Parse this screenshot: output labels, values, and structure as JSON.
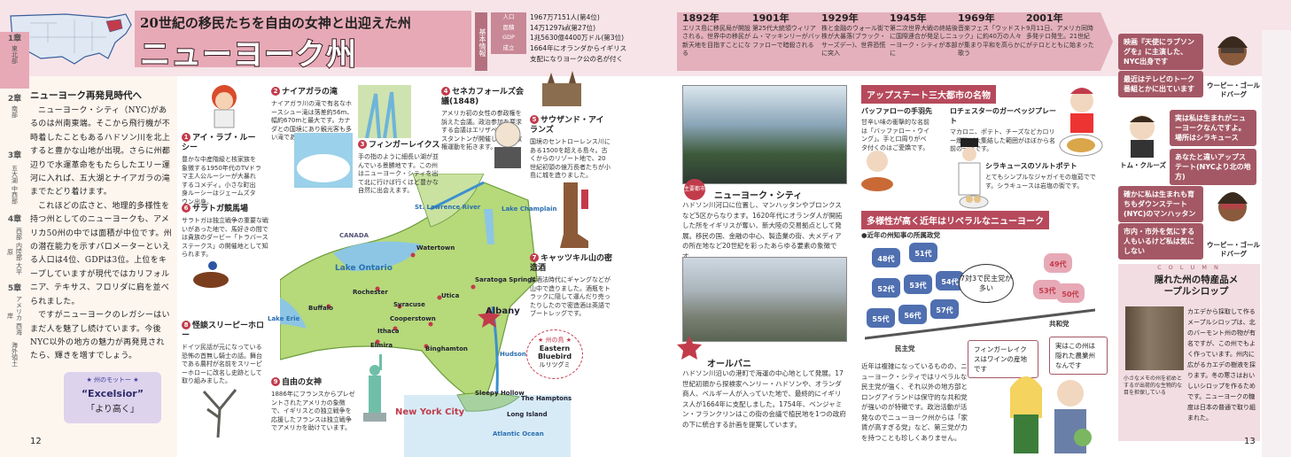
{
  "header": {
    "subtitle": "20世紀の移民たちを自由の女神と出迎えた州",
    "title": "ニューヨーク州",
    "basic_label": "基本情報",
    "basic": [
      {
        "k": "人口",
        "v": "1967万7151人(第4位)"
      },
      {
        "k": "面積",
        "v": "14万1297㎢(第27位)"
      },
      {
        "k": "GDP",
        "v": "1兆5630億4400万ドル(第3位)"
      },
      {
        "k": "成立",
        "v": "1664年にオランダからイギリス"
      },
      {
        "k": "",
        "v": "支配になりヨーク公の名が付く"
      }
    ],
    "timeline": [
      {
        "y": "1892年",
        "t": "エリス島に移民局が開設される。世界中の移民が新天地を目指すことになる"
      },
      {
        "y": "1901年",
        "t": "第25代大統領ウィリアム・マッキンリーがバッファローで暗殺される"
      },
      {
        "y": "1929年",
        "t": "株と金融のウォール街で株が大暴落(ブラック・サーズデー)、世界恐慌に突入"
      },
      {
        "y": "1945年",
        "t": "第二次世界大戦の終結後に国際連合が発足しニューヨーク・シティが本部に"
      },
      {
        "y": "1969年",
        "t": "音楽フェス「ウッドストック」に約40万の人々が集まり平和を高らかに歌う"
      },
      {
        "y": "2001年",
        "t": "9月11日、アメリカ同時多発テロ発生。21世紀がテロとともに始まった"
      }
    ]
  },
  "left": {
    "heading": "ニューヨーク再発見時代へ",
    "paras": [
      "ニューヨーク・シティ（NYC)があるのは州南東端。そこから飛行機が不時着したこともあるハドソン川を北上すると豊かな山地が出現。さらに州都辺りで水運革命をもたらしたエリー運河に入れば、五大湖とナイアガラの滝までたどり着けます。",
      "これほどの広さと、地理的多様性を持つ州としてのニューヨークも、アメリカ50州の中では面積が中位です。州の潜在能力を示すバロメーターといえる人口は4位、GDPは3位。上位をキープしていますが現代ではカリフォルニア、テキサス、フロリダに肩を並べられました。",
      "ですがニューヨークのレガシーはいまだ人を魅了し続けています。今後NYC以外の地方の魅力が再発見されたら、輝きを増すでしょう。"
    ],
    "motto_head": "★ 州のモットー ★",
    "motto": "“Excelsior”",
    "motto_jp": "「より高く」",
    "page": "12"
  },
  "spots": [
    {
      "n": "1",
      "h": "アイ・ラブ・ルーシー",
      "t": "豊かな中産階級と核家族を象徴する1950年代のTVドラマ主人公ルーシーが大暴れするコメディ。小さな町出身ルーシーはジェームズタウン出身。"
    },
    {
      "n": "2",
      "h": "ナイアガラの滝",
      "t": "ナイアガラ川の滝で有名なホースシュー滝は落差約56m、幅約670mと最大です。カナダとの国境にあり観光客も多い滝である"
    },
    {
      "n": "3",
      "h": "フィンガーレイクス",
      "t": "手の指のように細長い湖が並んでいる景勝地です。この州はニューヨーク・シティを出て北に行けば行くほど豊かな自然に出会えます。"
    },
    {
      "n": "4",
      "h": "セネカフォールズ会議(1848)",
      "t": "アメリカ初の女性の参政権を訴えた会議。政治参加を要求する会議はエリザベス・C・スタントンが開催し女性参政権運動を拓きます。"
    },
    {
      "n": "5",
      "h": "サウザンド・アイランズ",
      "t": "国境のセントローレンス川にある1500を超える島々。古くからのリゾート地で、20世紀初頭の億万長者たちが小島に城を造りました。"
    },
    {
      "n": "6",
      "h": "サラトガ競馬場",
      "t": "サラトガは独立戦争の重要な戦いがあった地で、馬好きの間では貴族のダービー「トラバースステークス」の開催地として知られます。"
    },
    {
      "n": "7",
      "h": "キャッツキル山の密造酒",
      "t": "禁酒法時代にギャングなどが山中で造りました。酒瓶をトラックに隠して運んだり売ったりしたので密造酒は英語でブートレッグです。"
    },
    {
      "n": "8",
      "h": "怪談スリーピーホロー",
      "t": "ドイツ民話が元になっている恐怖の首無し騎士の話。舞台である農村が名前をスリーピーホローに改名し史跡として取り組みました。"
    },
    {
      "n": "9",
      "h": "自由の女神",
      "t": "1886年にフランスからプレゼントされたアメリカの象徴で、イギリスとの独立戦争を応援したフランスは独立戦争でアメリカを助けています。"
    }
  ],
  "map": {
    "labels": [
      "CANADA",
      "St. Lawrence River",
      "Lake Champlain",
      "Lake Ontario",
      "Watertown",
      "Rochester",
      "Buffalo",
      "Syracuse",
      "Utica",
      "Saratoga Springs",
      "Lake Erie",
      "Albany",
      "Cooperstown",
      "Ithaca",
      "Elmira",
      "Binghamton",
      "Hudson River",
      "Sleepy Hollow",
      "The Hamptons",
      "Long Island",
      "Atlantic Ocean"
    ],
    "nyc": "New York City",
    "bird_head": "★ 州の鳥 ★",
    "bird": "Eastern Bluebird",
    "bird_jp": "ルリツグミ"
  },
  "cities": [
    {
      "badge": "主要都市",
      "name": "ニューヨーク・シティ",
      "t": "ハドソン川河口に位置し、マンハッタンやブロンクスなど5区からなります。1620年代にオランダ人が開拓した所をイギリスが奪い、新大陸の交易拠点として発展。移民の国、金融の中心、製造業の街、大メディアの所在地など20世紀を彩ったあらゆる要素の象徴です。"
    },
    {
      "badge": "州都",
      "name": "オールバニ",
      "t": "ハドソン川沿いの港町で海運の中心地として発展。17世紀初頭から探検家ヘンリー・ハドソンや、オランダ商人、ベルギー人が入っていた地で、最終的にイギリス人が1664年に支配しました。1754年、ベンジャミン・フランクリンはこの街の会議で植民地を1つの政府の下に統合する計画を提案しています。"
    }
  ],
  "foods": {
    "heading": "アップステート三大都市の名物",
    "items": [
      {
        "h": "バッファローの手羽先",
        "t": "甘辛い味の衝撃的な名前は「バッファロー・ウイング」。手と口周りがベタ付くのはご愛嬌です。"
      },
      {
        "h": "ロチェスターのガーベッジプレート",
        "t": "マカロニ、ポテト、チーズなどカロリー爆弾が大集結した範囲がほぼから名前の一品です。"
      },
      {
        "h": "シラキュースのソルトポテト",
        "t": "とてもシンプルなジャガイモの塩茹でです。シラキュースは岩塩の街です。"
      }
    ]
  },
  "politics": {
    "heading": "多様性が高く近年はリベラルなニューヨーク",
    "sub": "●近年の州知事の所属政党",
    "dem_label": "民主党",
    "rep_label": "共和党",
    "ratio": "7対3で民主党が多い",
    "dem": [
      "48代",
      "51代",
      "52代",
      "53代",
      "54代",
      "55代",
      "56代",
      "57代"
    ],
    "rep": [
      "49代",
      "50代",
      "53代"
    ],
    "dem_count": 7,
    "rep_count": 3,
    "bubble1": "フィンガーレイクスはワインの産地です",
    "bubble2": "実はこの州は隠れた農業州なんです",
    "body": "近年は複雑になっているものの、ニューヨーク・シティではリベラルな民主党が強く、それ以外の地方部とロングアイランドは保守的な共和党が強いのが特徴です。政治活動が活発なのでニューヨーク州からは「家賃が高すぎる党」など、第三党が力を持つことも珍しくありません。"
  },
  "quotes": [
    {
      "t": "映画『天使にラブソングを』に主演した、NYC出身です"
    },
    {
      "t": "最近はテレビのトーク番組とかに出ています"
    },
    {
      "t": "実は私は生まれがニューヨークなんですよ。場所はシラキュース"
    },
    {
      "t": "あなたと違いアップステート(NYCより北の地方)"
    },
    {
      "t": "確かに私は生まれも育ちもダウンステート(NYC)のマンハッタン"
    },
    {
      "t": "市内・市外を気にする人もいるけど私は気にしない"
    }
  ],
  "people": [
    "ウーピー・ゴールドバーグ",
    "トム・クルーズ",
    "ウーピー・ゴールドバーグ"
  ],
  "column": {
    "label": "C O L U M N",
    "title": "隠れた州の特産品メープルシロップ",
    "photo_cap": "小さなメモの州を初めとするが出荷的な生物的な目を担保している",
    "body": "カエデから採取して作るメープルシロップは、北のバーモント州の物が有名ですが、この州でもよく作っています。州内に広がるカエデの樹液を採ります。冬の寒さはおいしいシロップを作るためです。ニューヨークの糖度は日本の普通で取り組まれた。"
  },
  "tabs": [
    {
      "n": "1章",
      "t": "東北部"
    },
    {
      "n": "2章",
      "t": "南部"
    },
    {
      "n": "3章",
      "t": "五大湖 中西部"
    },
    {
      "n": "4章",
      "t": "西部 内陸部 大平原"
    },
    {
      "n": "5章",
      "t": "アメリカ 西海岸"
    },
    {
      "n": "",
      "t": "海外領土"
    }
  ],
  "right_page": "13",
  "colors": {
    "accent": "#b64a5c",
    "pink": "#e7a9b6",
    "map_green": "#b6d97a",
    "water": "#8cc6e4"
  }
}
